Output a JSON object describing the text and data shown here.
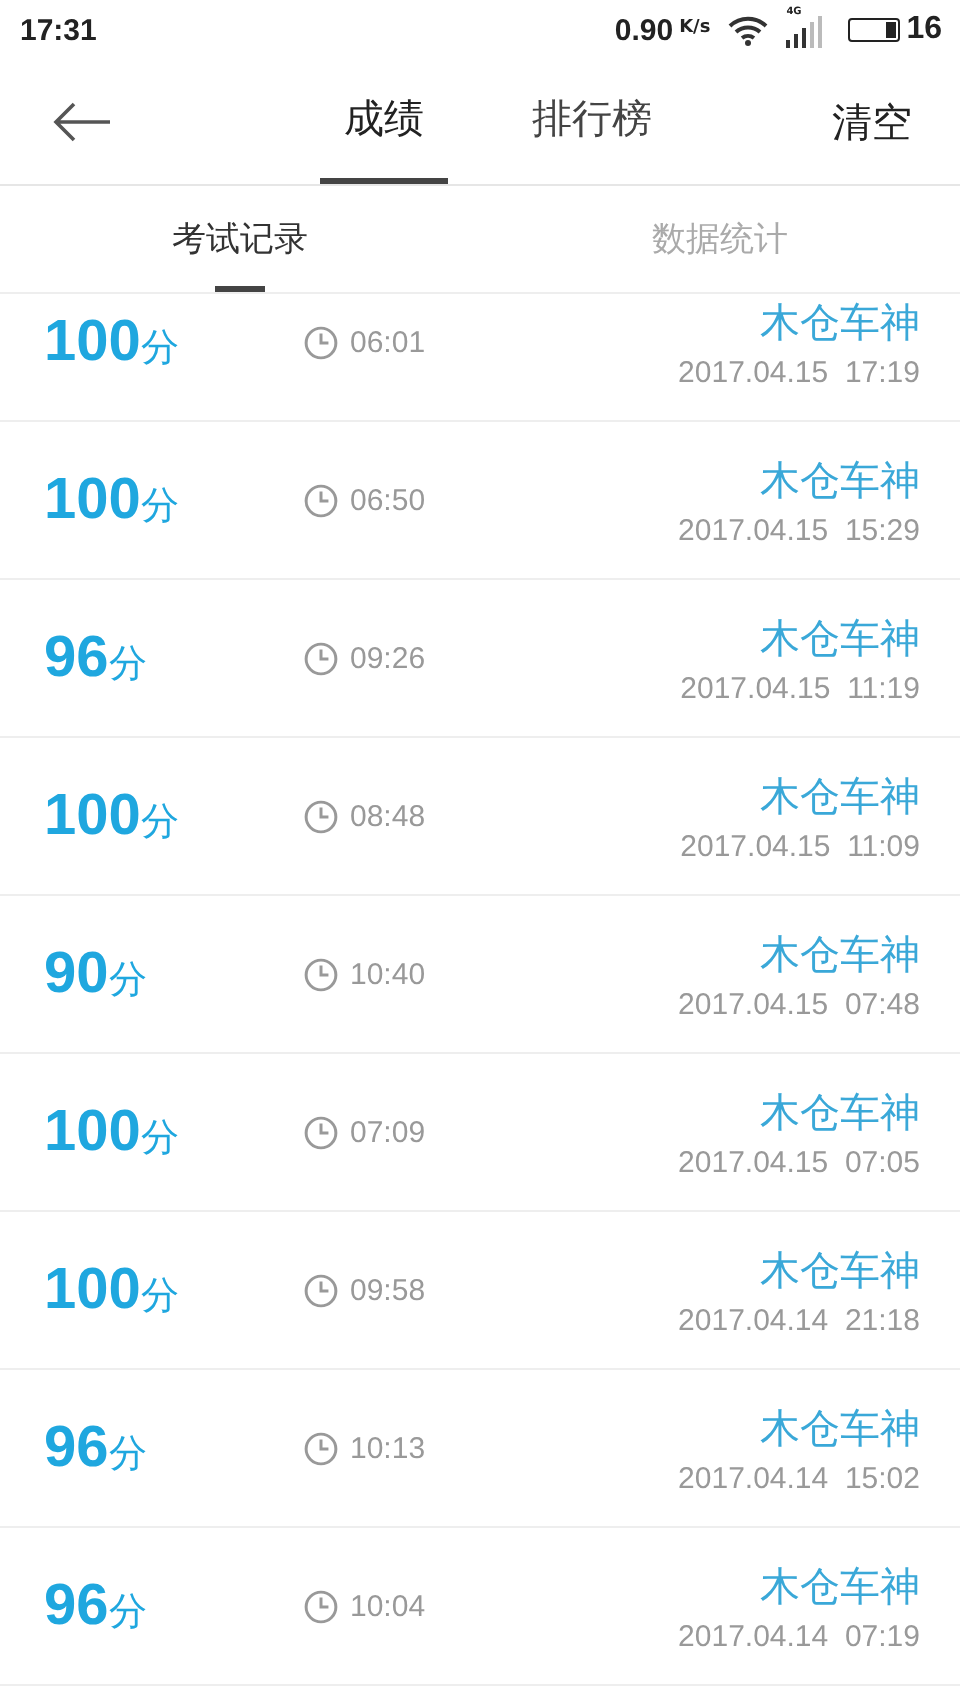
{
  "status_bar": {
    "time": "17:31",
    "speed": "0.90",
    "speed_unit": "K/s",
    "network": "4G",
    "battery": "16"
  },
  "nav": {
    "tabs": [
      {
        "label": "成绩",
        "selected": true
      },
      {
        "label": "排行榜",
        "selected": false
      }
    ],
    "action": "清空"
  },
  "sub_tabs": [
    {
      "label": "考试记录",
      "selected": true
    },
    {
      "label": "数据统计",
      "selected": false
    }
  ],
  "records": [
    {
      "score": "100",
      "unit": "分",
      "duration": "06:01",
      "name": "木仓车神",
      "date": "2017.04.15  17:19"
    },
    {
      "score": "100",
      "unit": "分",
      "duration": "06:50",
      "name": "木仓车神",
      "date": "2017.04.15  15:29"
    },
    {
      "score": "96",
      "unit": "分",
      "duration": "09:26",
      "name": "木仓车神",
      "date": "2017.04.15  11:19"
    },
    {
      "score": "100",
      "unit": "分",
      "duration": "08:48",
      "name": "木仓车神",
      "date": "2017.04.15  11:09"
    },
    {
      "score": "90",
      "unit": "分",
      "duration": "10:40",
      "name": "木仓车神",
      "date": "2017.04.15  07:48"
    },
    {
      "score": "100",
      "unit": "分",
      "duration": "07:09",
      "name": "木仓车神",
      "date": "2017.04.15  07:05"
    },
    {
      "score": "100",
      "unit": "分",
      "duration": "09:58",
      "name": "木仓车神",
      "date": "2017.04.14  21:18"
    },
    {
      "score": "96",
      "unit": "分",
      "duration": "10:13",
      "name": "木仓车神",
      "date": "2017.04.14  15:02"
    },
    {
      "score": "96",
      "unit": "分",
      "duration": "10:04",
      "name": "木仓车神",
      "date": "2017.04.14  07:19"
    }
  ]
}
